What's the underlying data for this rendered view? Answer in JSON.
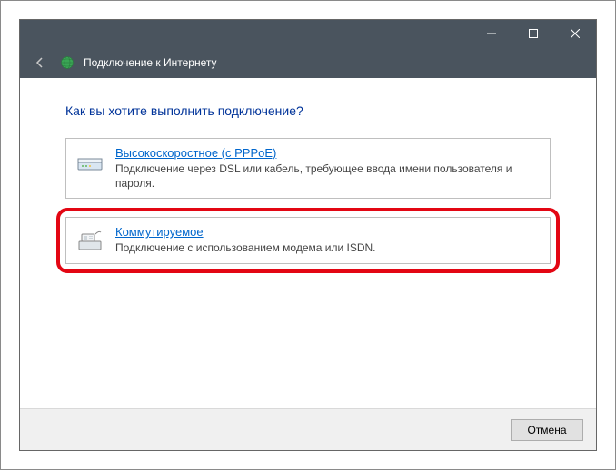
{
  "window": {
    "title": "Подключение к Интернету"
  },
  "heading": "Как вы хотите выполнить подключение?",
  "options": {
    "broadband": {
      "title": "Высокоскоростное (с PPPoE)",
      "desc": "Подключение через DSL или кабель, требующее ввода имени пользователя и пароля."
    },
    "dialup": {
      "title": "Коммутируемое",
      "desc": "Подключение с использованием модема или ISDN."
    }
  },
  "footer": {
    "cancel": "Отмена"
  }
}
